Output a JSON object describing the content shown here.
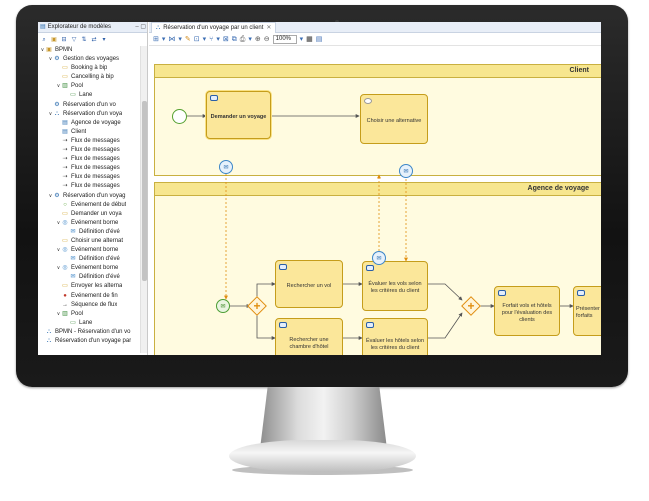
{
  "explorer": {
    "tab_title": "Explorateur de modèles",
    "tree": [
      {
        "label": "BPMN",
        "icon": "package-icon",
        "indent": 0,
        "expanded": true
      },
      {
        "label": "Gestion des voyages",
        "icon": "process-icon",
        "indent": 1,
        "expanded": true
      },
      {
        "label": "Booking à bip",
        "icon": "task-icon",
        "indent": 2
      },
      {
        "label": "Cancelling à bip",
        "icon": "task-icon",
        "indent": 2
      },
      {
        "label": "Pool",
        "icon": "pool-icon",
        "indent": 2,
        "expanded": true
      },
      {
        "label": "Lane",
        "icon": "lane-icon",
        "indent": 3
      },
      {
        "label": "Réservation d'un vo",
        "icon": "process-icon",
        "indent": 1
      },
      {
        "label": "Réservation d'un voya",
        "icon": "collaboration-icon",
        "indent": 1,
        "expanded": true
      },
      {
        "label": "Agence de voyage",
        "icon": "participant-icon",
        "indent": 2
      },
      {
        "label": "Client",
        "icon": "participant-icon",
        "indent": 2
      },
      {
        "label": "Flux de messages",
        "icon": "message-flow-icon",
        "indent": 2
      },
      {
        "label": "Flux de messages",
        "icon": "message-flow-icon",
        "indent": 2
      },
      {
        "label": "Flux de messages",
        "icon": "message-flow-icon",
        "indent": 2
      },
      {
        "label": "Flux de messages",
        "icon": "message-flow-icon",
        "indent": 2
      },
      {
        "label": "Flux de messages",
        "icon": "message-flow-icon",
        "indent": 2
      },
      {
        "label": "Flux de messages",
        "icon": "message-flow-icon",
        "indent": 2
      },
      {
        "label": "Réservation d'un voyag",
        "icon": "process-icon",
        "indent": 1,
        "expanded": true
      },
      {
        "label": "Événement de début",
        "icon": "start-event-icon",
        "indent": 2
      },
      {
        "label": "Demander un voya",
        "icon": "task-icon",
        "indent": 2
      },
      {
        "label": "Événement borne",
        "icon": "boundary-event-icon",
        "indent": 2,
        "expanded": true
      },
      {
        "label": "Définition d'évé",
        "icon": "event-definition-icon",
        "indent": 3
      },
      {
        "label": "Choisir une alternat",
        "icon": "task-icon",
        "indent": 2
      },
      {
        "label": "Événement borne",
        "icon": "boundary-event-icon",
        "indent": 2,
        "expanded": true
      },
      {
        "label": "Définition d'évé",
        "icon": "event-definition-icon",
        "indent": 3
      },
      {
        "label": "Événement borne",
        "icon": "boundary-event-icon",
        "indent": 2,
        "expanded": true
      },
      {
        "label": "Définition d'évé",
        "icon": "event-definition-icon",
        "indent": 3
      },
      {
        "label": "Envoyer les alterna",
        "icon": "task-icon",
        "indent": 2
      },
      {
        "label": "Événement de fin",
        "icon": "end-event-icon",
        "indent": 2
      },
      {
        "label": "Séquence de flux",
        "icon": "sequence-flow-icon",
        "indent": 2
      },
      {
        "label": "Pool",
        "icon": "pool-icon",
        "indent": 2,
        "expanded": true
      },
      {
        "label": "Lane",
        "icon": "lane-icon",
        "indent": 3
      },
      {
        "label": "BPMN - Réservation d'un vo",
        "icon": "diagram-icon",
        "indent": 0
      },
      {
        "label": "Réservation d'un voyage par",
        "icon": "diagram-icon",
        "indent": 0
      }
    ]
  },
  "editor": {
    "tab_title": "Réservation d'un voyage par un client",
    "zoom": "100%",
    "lanes": {
      "client": "Client",
      "agency": "Agence de voyage"
    },
    "tasks": {
      "demander": "Demander un voyage",
      "choisir": "Choisir une alternative",
      "rechercher_vol": "Rechercher un vol",
      "rechercher_hotel": "Rechercher une chambre d'hôtel",
      "evaluer_vols": "Évaluer les vols selon les critères du client",
      "evaluer_hotels": "Évaluer les hôtels selon les critères du client",
      "forfait": "Forfait vols et hôtels pour l'évaluation des clients",
      "presenter": "Présenter les forfaits"
    }
  },
  "colors": {
    "lane_fill": "#fffbe0",
    "lane_header": "#f7e68f",
    "task_fill": "#fbe79a",
    "task_border": "#c59d1b",
    "message_flow": "#e08e10",
    "gateway": "#e08e10",
    "message_event": "#3d86c8",
    "start_event": "#55a030"
  }
}
